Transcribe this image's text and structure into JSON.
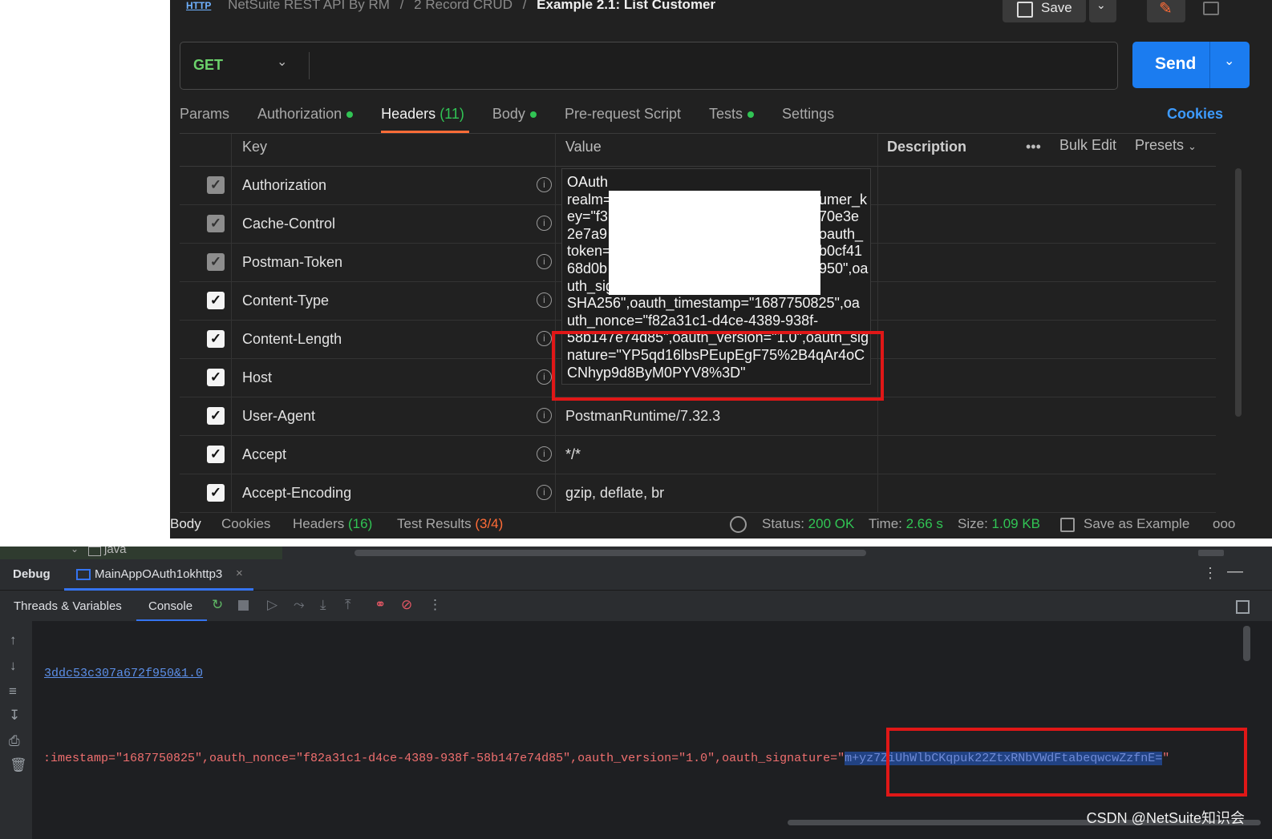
{
  "postman": {
    "breadcrumb": {
      "http_badge": "HTTP",
      "collection": "NetSuite REST API By RM",
      "folder": "2 Record CRUD",
      "request": "Example 2.1: List Customer",
      "separator": "/"
    },
    "save_label": "Save",
    "method": "GET",
    "url": "",
    "send_label": "Send",
    "tabs": [
      {
        "label": "Params",
        "dot": false
      },
      {
        "label": "Authorization",
        "dot": true
      },
      {
        "label": "Headers",
        "count": "(11)",
        "dot": false,
        "active": true
      },
      {
        "label": "Body",
        "dot": true
      },
      {
        "label": "Pre-request Script",
        "dot": false
      },
      {
        "label": "Tests",
        "dot": true
      },
      {
        "label": "Settings",
        "dot": false
      }
    ],
    "cookies_link": "Cookies",
    "columns": {
      "key": "Key",
      "value": "Value",
      "description": "Description",
      "more": "•••",
      "bulk_edit": "Bulk Edit",
      "presets": "Presets"
    },
    "headers": [
      {
        "key": "Authorization",
        "value": "",
        "checked": true,
        "auto": true
      },
      {
        "key": "Cache-Control",
        "value": "",
        "checked": true,
        "auto": true
      },
      {
        "key": "Postman-Token",
        "value": "",
        "checked": true,
        "auto": true
      },
      {
        "key": "Content-Type",
        "value": "",
        "checked": true,
        "auto": false
      },
      {
        "key": "Content-Length",
        "value": "",
        "checked": true,
        "auto": false
      },
      {
        "key": "Host",
        "value": "",
        "checked": true,
        "auto": false
      },
      {
        "key": "User-Agent",
        "value": "PostmanRuntime/7.32.3",
        "checked": true,
        "auto": false
      },
      {
        "key": "Accept",
        "value": "*/*",
        "checked": true,
        "auto": false
      },
      {
        "key": "Accept-Encoding",
        "value": "gzip, deflate, br",
        "checked": true,
        "auto": false
      }
    ],
    "auth_popup_lines": [
      "OAuth",
      "realm=",
      "ey=\"f3",
      "2e7a9",
      "token=",
      "68d0b",
      "uth_sig",
      "SHA256\",oauth_timestamp=\"1687750825\",oa",
      "uth_nonce=\"f82a31c1-d4ce-4389-938f-",
      "58b147e74d85\",oauth_version=\"1.0\",oauth_sig",
      "nature=\"YP5qd16lbsPEupEgF75%2B4qAr4oC",
      "CNhyp9d8ByM0PYV8%3D\""
    ],
    "auth_popup_right_fragments": [
      "umer_k",
      "70e3e",
      "oauth_",
      "b0cf41",
      "950\",oa"
    ],
    "response_bar": {
      "body": "Body",
      "cookies": "Cookies",
      "headers": "Headers",
      "headers_count": "(16)",
      "test_results": "Test Results",
      "test_count": "(3/4)",
      "status_label": "Status:",
      "status_value": "200 OK",
      "time_label": "Time:",
      "time_value": "2.66 s",
      "size_label": "Size:",
      "size_value": "1.09 KB",
      "save_example": "Save as Example",
      "more": "ooo"
    },
    "accent_colors": {
      "send": "#1b7cf0",
      "tab_underline": "#ff6c37",
      "ok": "#31c454",
      "highlight_box": "#e01717"
    }
  },
  "ide": {
    "project_folder": "java",
    "debug_label": "Debug",
    "session_tab": "MainAppOAuth1okhttp3",
    "sub_tabs": [
      "Threads & Variables",
      "Console"
    ],
    "console_link": "3ddc53c307a672f950&1.0",
    "console_line_prefix": ":imestamp=\"1687750825\",oauth_nonce=\"f82a31c1-d4ce-4389-938f-58b147e74d85\",oauth_version=\"1.0\",oauth_signature=\"",
    "console_selected": "m+yz7ZiUhWlbCKqpuk22ZtxRNbVWdFtabeqwcwZzfnE=",
    "console_line_suffix": "\"",
    "watermark": "CSDN @NetSuite知识会"
  }
}
